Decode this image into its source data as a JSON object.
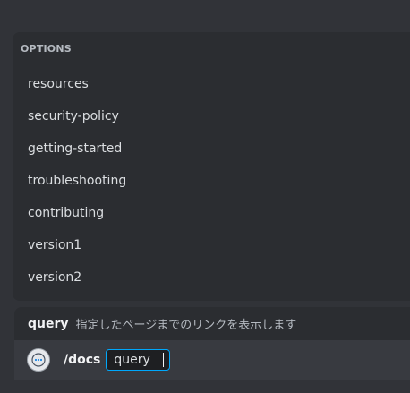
{
  "options": {
    "header": "OPTIONS",
    "items": [
      {
        "label": "resources"
      },
      {
        "label": "security-policy"
      },
      {
        "label": "getting-started"
      },
      {
        "label": "troubleshooting"
      },
      {
        "label": "contributing"
      },
      {
        "label": "version1"
      },
      {
        "label": "version2"
      }
    ]
  },
  "command_hint": {
    "param_name": "query",
    "description": "指定したページまでのリンクを表示します"
  },
  "input": {
    "avatar_icon": "bot-avatar-icon",
    "command": "/docs",
    "param_label": "query"
  }
}
